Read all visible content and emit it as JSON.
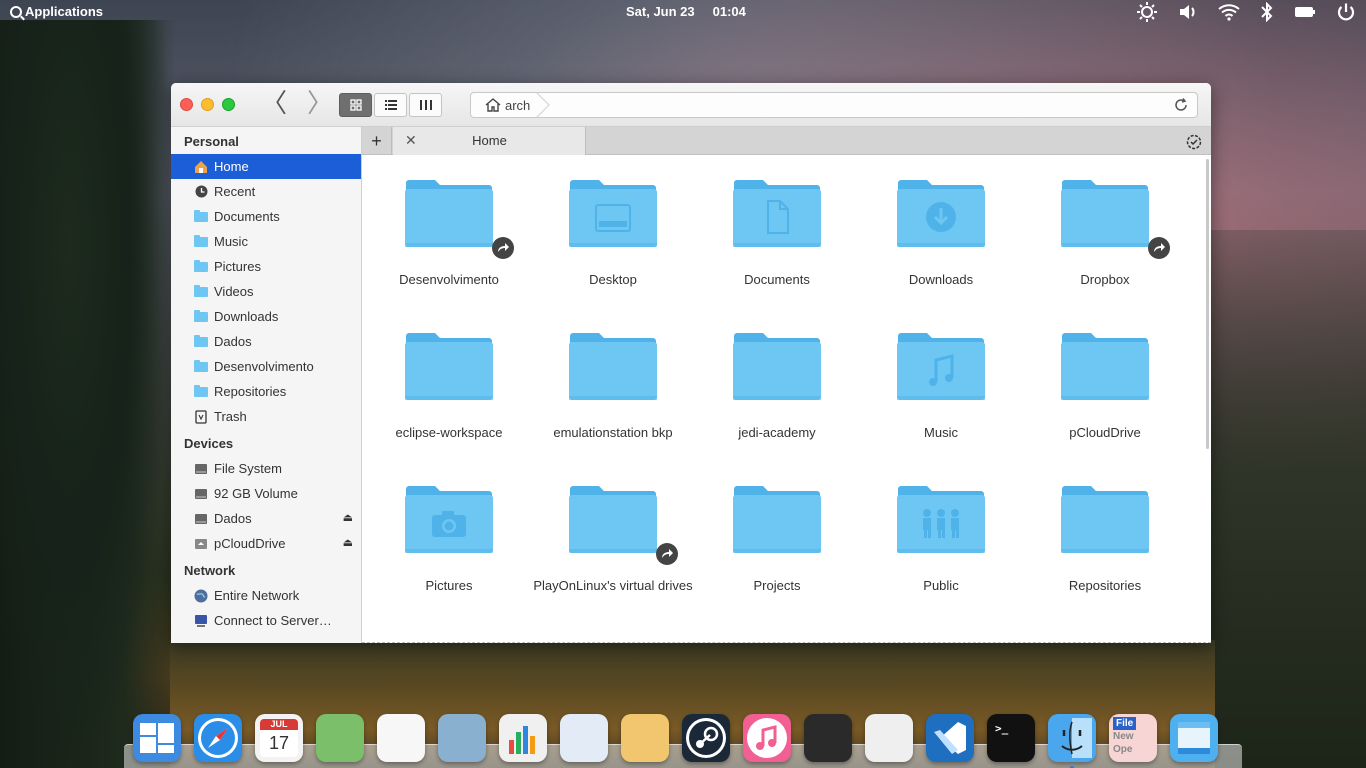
{
  "top_panel": {
    "applications_label": "Applications",
    "date": "Sat, Jun 23",
    "time": "01:04"
  },
  "toolbar": {
    "path_label": "arch"
  },
  "tab": {
    "label": "Home"
  },
  "sidebar": {
    "sections": [
      {
        "title": "Personal",
        "items": [
          {
            "label": "Home",
            "icon": "home-icon"
          },
          {
            "label": "Recent",
            "icon": "clock-icon"
          },
          {
            "label": "Documents",
            "icon": "folder-icon"
          },
          {
            "label": "Music",
            "icon": "folder-icon"
          },
          {
            "label": "Pictures",
            "icon": "folder-icon"
          },
          {
            "label": "Videos",
            "icon": "folder-icon"
          },
          {
            "label": "Downloads",
            "icon": "folder-icon"
          },
          {
            "label": "Dados",
            "icon": "folder-icon"
          },
          {
            "label": "Desenvolvimento",
            "icon": "folder-icon"
          },
          {
            "label": "Repositories",
            "icon": "folder-icon"
          },
          {
            "label": "Trash",
            "icon": "trash-icon"
          }
        ]
      },
      {
        "title": "Devices",
        "items": [
          {
            "label": "File System",
            "icon": "drive-icon"
          },
          {
            "label": "92 GB Volume",
            "icon": "drive-icon"
          },
          {
            "label": "Dados",
            "icon": "drive-icon",
            "eject": true
          },
          {
            "label": "pCloudDrive",
            "icon": "removable-drive-icon",
            "eject": true
          }
        ]
      },
      {
        "title": "Network",
        "items": [
          {
            "label": "Entire Network",
            "icon": "globe-icon"
          },
          {
            "label": "Connect to Server…",
            "icon": "server-icon"
          }
        ]
      }
    ]
  },
  "folders": [
    {
      "label": "Desenvolvimento",
      "emblem": "none",
      "link": true
    },
    {
      "label": "Desktop",
      "emblem": "desktop",
      "link": false
    },
    {
      "label": "Documents",
      "emblem": "document",
      "link": false
    },
    {
      "label": "Downloads",
      "emblem": "download",
      "link": false
    },
    {
      "label": "Dropbox",
      "emblem": "none",
      "link": true
    },
    {
      "label": "eclipse-workspace",
      "emblem": "none",
      "link": false
    },
    {
      "label": "emulationstation bkp",
      "emblem": "none",
      "link": false
    },
    {
      "label": "jedi-academy",
      "emblem": "none",
      "link": false
    },
    {
      "label": "Music",
      "emblem": "music",
      "link": false
    },
    {
      "label": "pCloudDrive",
      "emblem": "none",
      "link": false
    },
    {
      "label": "Pictures",
      "emblem": "camera",
      "link": false
    },
    {
      "label": "PlayOnLinux's virtual drives",
      "emblem": "none",
      "link": true
    },
    {
      "label": "Projects",
      "emblem": "none",
      "link": false
    },
    {
      "label": "Public",
      "emblem": "people",
      "link": false
    },
    {
      "label": "Repositories",
      "emblem": "none",
      "link": false
    }
  ],
  "dock": {
    "apps": [
      {
        "name": "multitasking-view",
        "color": "#3d8be0",
        "running": false
      },
      {
        "name": "web-browser",
        "color": "#2a8ee8",
        "running": false
      },
      {
        "name": "calendar",
        "color": "#f3f3f3",
        "running": false
      },
      {
        "name": "maps",
        "color": "#7bbf6a",
        "running": false
      },
      {
        "name": "reminders",
        "color": "#f7f7f7",
        "running": false
      },
      {
        "name": "image-viewer",
        "color": "#8ab0d0",
        "running": false
      },
      {
        "name": "charts",
        "color": "#f0f0f0",
        "running": false
      },
      {
        "name": "presentation",
        "color": "#e3ecf6",
        "running": false
      },
      {
        "name": "text-editor",
        "color": "#f1c66e",
        "running": false
      },
      {
        "name": "steam",
        "color": "#1b2838",
        "running": false
      },
      {
        "name": "music-player",
        "color": "#f25f92",
        "running": false
      },
      {
        "name": "video-editor",
        "color": "#2a2a2a",
        "running": false
      },
      {
        "name": "task-list",
        "color": "#efefef",
        "running": false
      },
      {
        "name": "code-editor",
        "color": "#1e6fbf",
        "running": false
      },
      {
        "name": "terminal",
        "color": "#111111",
        "running": false
      },
      {
        "name": "file-manager",
        "color": "#4aa7ee",
        "running": true
      },
      {
        "name": "file-roller",
        "color": "#f7d5d5",
        "running": false
      },
      {
        "name": "window",
        "color": "#4fb0f0",
        "running": false
      }
    ],
    "calendar_month": "JUL",
    "calendar_day": "17",
    "file_roller_text_1": "File",
    "file_roller_text_2": "New",
    "file_roller_text_3": "Ope"
  },
  "colors": {
    "folder": "#6ec6f3",
    "folder_dark": "#4fb3ea",
    "selection": "#1c5ed8"
  }
}
